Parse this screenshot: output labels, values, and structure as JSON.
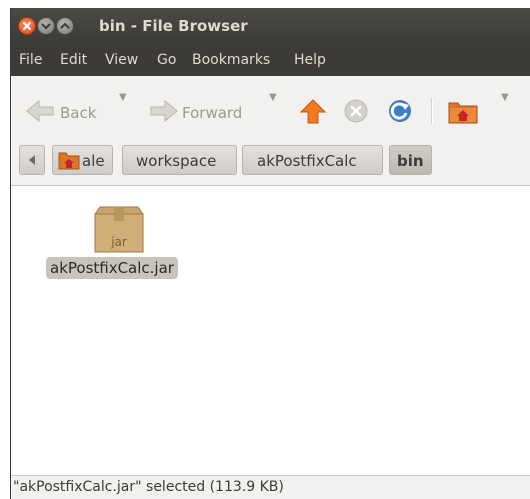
{
  "window": {
    "title": "bin - File Browser"
  },
  "menubar": {
    "items": [
      "File",
      "Edit",
      "View",
      "Go",
      "Bookmarks",
      "Help"
    ]
  },
  "toolbar": {
    "back_label": "Back",
    "forward_label": "Forward",
    "icons": [
      "back-arrow-icon",
      "forward-arrow-icon",
      "up-arrow-icon",
      "stop-icon",
      "reload-icon",
      "home-folder-icon"
    ]
  },
  "pathbar": {
    "crumbs": [
      "ale",
      "workspace",
      "akPostfixCalc",
      "bin"
    ]
  },
  "files": [
    {
      "name": "akPostfixCalc.jar",
      "icon_text": "jar",
      "selected": true
    }
  ],
  "statusbar": {
    "text": "\"akPostfixCalc.jar\" selected (113.9 KB)"
  },
  "colors": {
    "titlebar": "#3c3b37",
    "title_text": "#dfdbd2",
    "close_button": "#e2471b",
    "selection": "#c9c4bb",
    "up_arrow": "#f07a1d",
    "reload": "#3f7ccd"
  }
}
